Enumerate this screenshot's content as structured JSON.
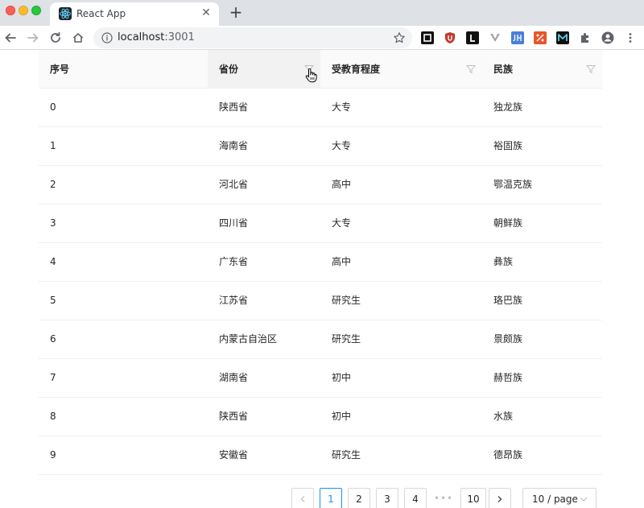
{
  "browser": {
    "tab_title": "React App",
    "url_host": "localhost",
    "url_port": ":3001"
  },
  "table": {
    "columns": [
      "序号",
      "省份",
      "受教育程度",
      "民族"
    ],
    "filterable_columns": [
      false,
      true,
      true,
      true
    ],
    "rows": [
      [
        "0",
        "陕西省",
        "大专",
        "独龙族"
      ],
      [
        "1",
        "海南省",
        "大专",
        "裕固族"
      ],
      [
        "2",
        "河北省",
        "高中",
        "鄂温克族"
      ],
      [
        "3",
        "四川省",
        "大专",
        "朝鲜族"
      ],
      [
        "4",
        "广东省",
        "高中",
        "彝族"
      ],
      [
        "5",
        "江苏省",
        "研究生",
        "珞巴族"
      ],
      [
        "6",
        "内蒙古自治区",
        "研究生",
        "景颇族"
      ],
      [
        "7",
        "湖南省",
        "初中",
        "赫哲族"
      ],
      [
        "8",
        "陕西省",
        "初中",
        "水族"
      ],
      [
        "9",
        "安徽省",
        "研究生",
        "德昂族"
      ]
    ]
  },
  "pagination": {
    "pages": [
      "1",
      "2",
      "3",
      "4"
    ],
    "ellipsis": "•••",
    "last_page": "10",
    "current_page": "1",
    "page_size_label": "10 / page"
  },
  "colors": {
    "accent": "#1890ff",
    "header_bg": "#fafafa",
    "border": "#f0f0f0"
  }
}
